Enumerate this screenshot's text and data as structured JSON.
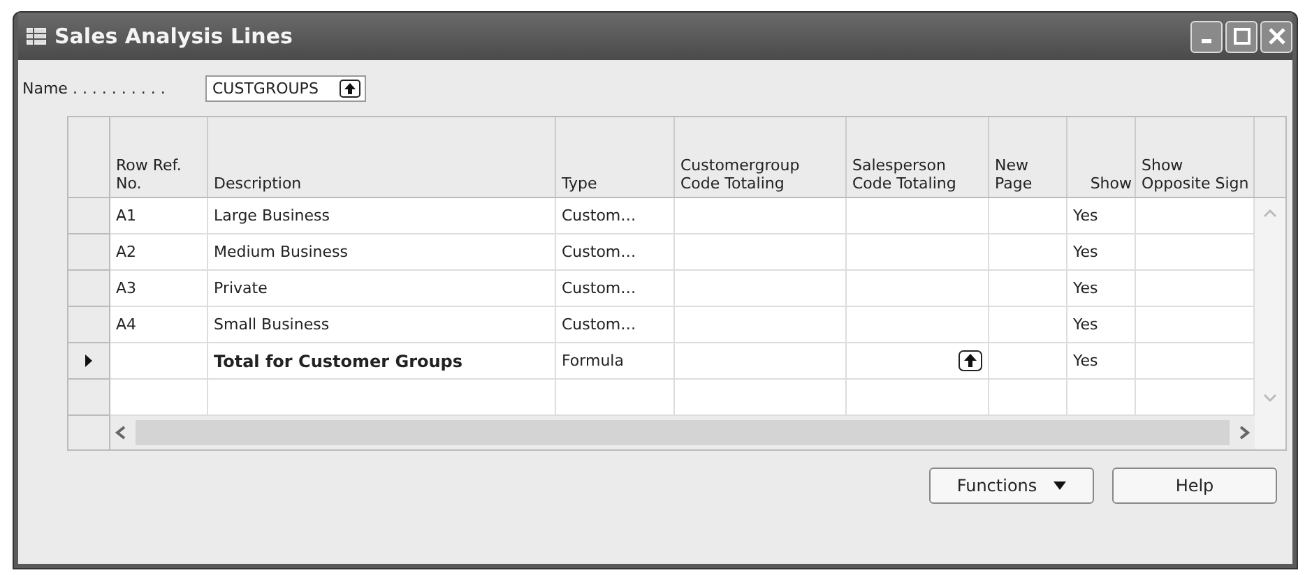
{
  "window": {
    "title": "Sales Analysis Lines"
  },
  "name_field": {
    "label": "Name . . . . . . . . . .",
    "value": "CUSTGROUPS"
  },
  "table": {
    "columns": [
      "Row Ref. No.",
      "Description",
      "Type",
      "Customergroup Code Totaling",
      "Salesperson Code Totaling",
      "New Page",
      "Show",
      "Show Opposite Sign"
    ],
    "rows": [
      {
        "current": false,
        "bold": false,
        "salesperson_lookup": false,
        "cells": [
          "A1",
          "Large Business",
          "Custom…",
          "",
          "",
          "",
          "Yes",
          ""
        ]
      },
      {
        "current": false,
        "bold": false,
        "salesperson_lookup": false,
        "cells": [
          "A2",
          "Medium Business",
          "Custom…",
          "",
          "",
          "",
          "Yes",
          ""
        ]
      },
      {
        "current": false,
        "bold": false,
        "salesperson_lookup": false,
        "cells": [
          "A3",
          "Private",
          "Custom…",
          "",
          "",
          "",
          "Yes",
          ""
        ]
      },
      {
        "current": false,
        "bold": false,
        "salesperson_lookup": false,
        "cells": [
          "A4",
          "Small Business",
          "Custom…",
          "",
          "",
          "",
          "Yes",
          ""
        ]
      },
      {
        "current": true,
        "bold": true,
        "salesperson_lookup": true,
        "cells": [
          "",
          "Total for Customer Groups",
          "Formula",
          "",
          "",
          "",
          "Yes",
          ""
        ]
      }
    ]
  },
  "buttons": [
    {
      "label": "Functions",
      "dropdown": true
    },
    {
      "label": "Help",
      "dropdown": false
    }
  ]
}
